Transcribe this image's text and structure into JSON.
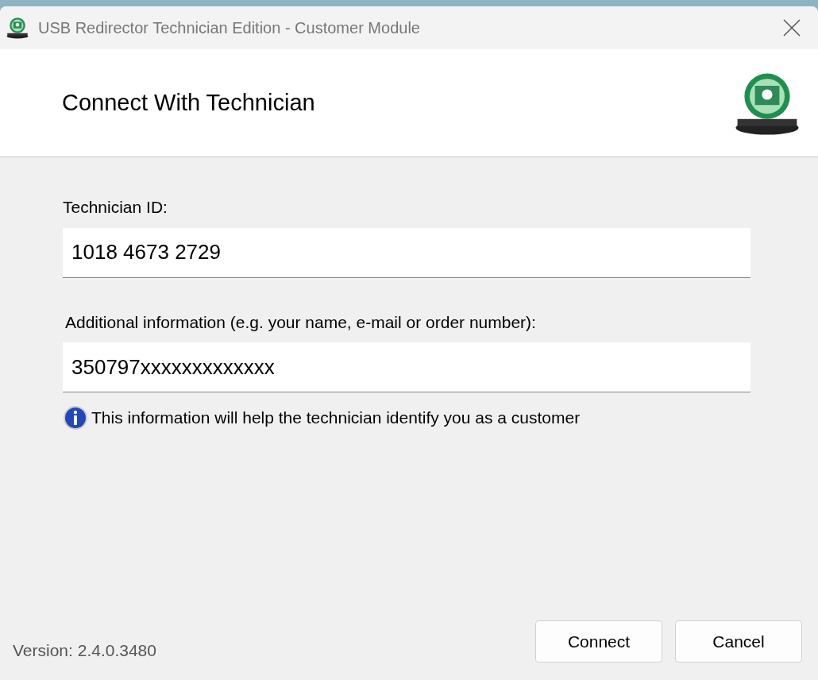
{
  "window": {
    "title": "USB Redirector Technician Edition - Customer Module"
  },
  "header": {
    "title": "Connect With Technician"
  },
  "fields": [
    {
      "label": "Technician ID:",
      "value": "1018 4673 2729"
    },
    {
      "label": "Additional information (e.g. your name, e-mail or order number):",
      "value": "350797xxxxxxxxxxxxx"
    }
  ],
  "hint": "This information will help the technician identify you as a customer",
  "version": "Version: 2.4.0.3480",
  "buttons": [
    "Connect",
    "Cancel"
  ]
}
